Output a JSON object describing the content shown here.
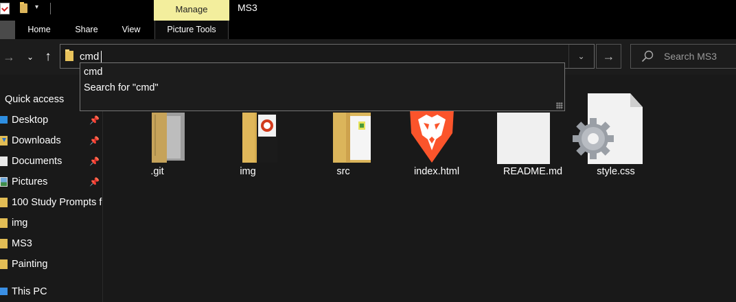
{
  "window": {
    "title": "MS3",
    "manage_tab": "Manage"
  },
  "quick_access_toolbar": {
    "dropdown_glyph": "▾"
  },
  "ribbon": {
    "tabs": [
      "Home",
      "Share",
      "View",
      "Picture Tools"
    ]
  },
  "nav": {
    "back_glyph": "→",
    "recent_glyph": "⌄",
    "up_glyph": "↑"
  },
  "address_bar": {
    "value": "cmd",
    "dropdown_glyph": "⌄",
    "go_glyph": "→"
  },
  "search": {
    "placeholder": "Search MS3"
  },
  "autocomplete": {
    "items": [
      "cmd",
      "Search for \"cmd\""
    ]
  },
  "navigation_pane": {
    "items": [
      {
        "label": "Quick access",
        "icon": "star-icon",
        "pinned": false
      },
      {
        "label": "Desktop",
        "icon": "desktop-icon",
        "pinned": true
      },
      {
        "label": "Downloads",
        "icon": "download-icon",
        "pinned": true
      },
      {
        "label": "Documents",
        "icon": "documents-icon",
        "pinned": true
      },
      {
        "label": "Pictures",
        "icon": "pictures-icon",
        "pinned": true
      },
      {
        "label": "100 Study Prompts f",
        "icon": "folder-icon",
        "pinned": false
      },
      {
        "label": "img",
        "icon": "folder-icon",
        "pinned": false
      },
      {
        "label": "MS3",
        "icon": "folder-icon",
        "pinned": false
      },
      {
        "label": "Painting",
        "icon": "folder-icon",
        "pinned": false
      },
      {
        "label": "This PC",
        "icon": "pc-icon",
        "pinned": false
      }
    ],
    "pin_glyph": "📌"
  },
  "files": [
    {
      "name": ".git",
      "type": "folder"
    },
    {
      "name": "img",
      "type": "folder"
    },
    {
      "name": "src",
      "type": "folder"
    },
    {
      "name": "index.html",
      "type": "html"
    },
    {
      "name": "README.md",
      "type": "file"
    },
    {
      "name": "style.css",
      "type": "css"
    }
  ],
  "colors": {
    "background": "#191919",
    "ribbon": "#000000",
    "manage_tab": "#f3ee9d",
    "folder": "#dcb55b",
    "brave_orange": "#fb542b"
  }
}
